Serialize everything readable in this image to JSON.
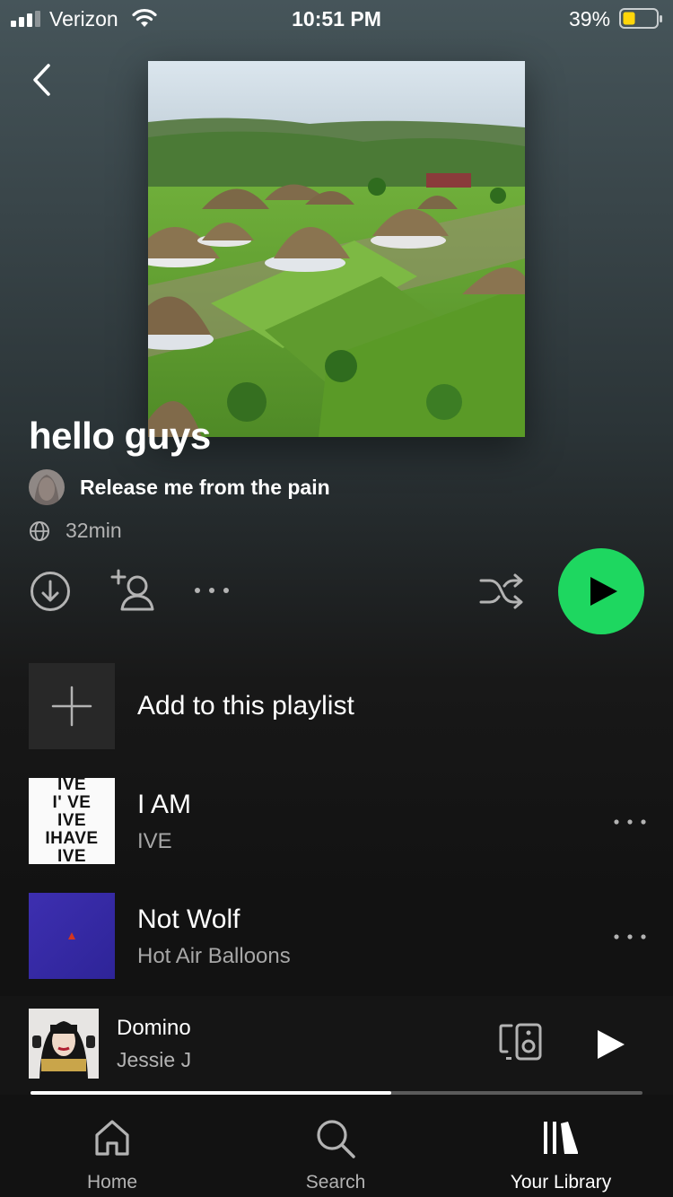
{
  "status_bar": {
    "carrier": "Verizon",
    "time": "10:51 PM",
    "battery_percent": "39%"
  },
  "playlist": {
    "title": "hello guys",
    "owner": "Release me from the pain",
    "duration": "32min"
  },
  "add_row": {
    "label": "Add to this playlist"
  },
  "tracks": [
    {
      "title": "I AM",
      "artist": "IVE"
    },
    {
      "title": "Not Wolf",
      "artist": "Hot Air Balloons"
    }
  ],
  "ive_cover_text": [
    "IVE",
    "I'  VE",
    "IVE",
    "IHAVE",
    "IVE"
  ],
  "now_playing": {
    "title": "Domino",
    "artist": "Jessie J",
    "progress": 0.59
  },
  "nav": {
    "home": "Home",
    "search": "Search",
    "library": "Your Library"
  },
  "colors": {
    "accent_green": "#1ed760",
    "battery_yellow": "#ffd60a"
  },
  "icons": [
    "chevron-left-icon",
    "download-icon",
    "add-user-icon",
    "more-icon",
    "shuffle-icon",
    "play-icon",
    "globe-icon",
    "plus-icon",
    "devices-icon",
    "home-icon",
    "search-icon",
    "library-icon"
  ]
}
